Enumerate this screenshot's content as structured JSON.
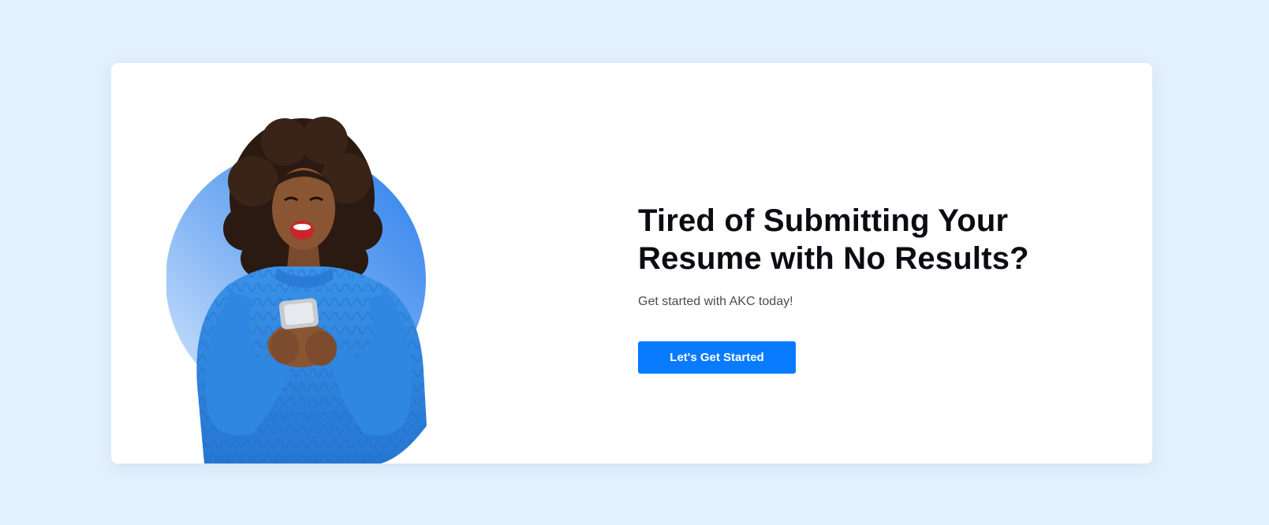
{
  "banner": {
    "headline": "Tired of Submitting Your Resume with No Results?",
    "subtext": "Get started with AKC today!",
    "cta_label": "Let's Get Started"
  },
  "colors": {
    "page_background": "#e3f0fd",
    "card_background": "#ffffff",
    "accent": "#087bff",
    "circle_gradient_start": "#c9e0fb",
    "circle_gradient_end": "#2f83ee",
    "sweater": "#2b86e0",
    "hair": "#2b1a12"
  },
  "icons": {
    "hero_image": "woman-with-phone-illustration"
  }
}
